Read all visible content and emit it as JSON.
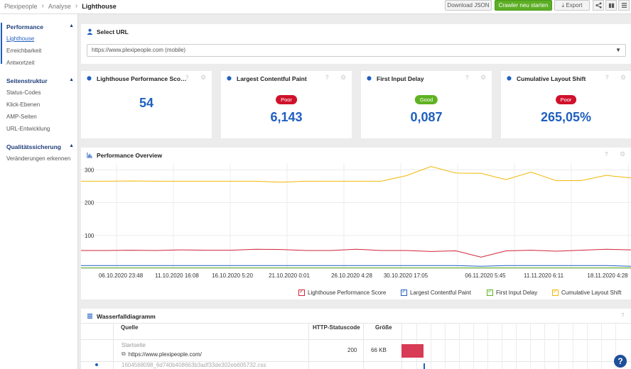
{
  "breadcrumb": {
    "items": [
      "Plexipeople",
      "Analyse"
    ],
    "current": "Lighthouse"
  },
  "toolbar": {
    "download_json": "Download JSON",
    "crawler_restart": "Crawler neu starten",
    "export": "Export"
  },
  "sidebar": {
    "sections": [
      {
        "title": "Performance",
        "items": [
          "Lighthouse",
          "Erreichbarkeit",
          "Antwortzeit"
        ]
      },
      {
        "title": "Seitenstruktur",
        "items": [
          "Status-Codes",
          "Klick-Ebenen",
          "AMP-Seiten",
          "URL-Entwicklung"
        ]
      },
      {
        "title": "Qualitätssicherung",
        "items": [
          "Veränderungen erkennen"
        ]
      }
    ]
  },
  "select_url": {
    "title": "Select URL",
    "value": "https://www.plexipeople.com (mobile)"
  },
  "metrics": [
    {
      "title": "Lighthouse Performance Sco…",
      "value": "54",
      "badge": ""
    },
    {
      "title": "Largest Contentful Paint",
      "value": "6,143",
      "badge": "Poor"
    },
    {
      "title": "First Input Delay",
      "value": "0,087",
      "badge": "Good"
    },
    {
      "title": "Cumulative Layout Shift",
      "value": "265,05%",
      "badge": "Poor"
    }
  ],
  "colors": {
    "poor": "#d0112b",
    "good": "#5fb221",
    "accent": "#1f5fbf"
  },
  "overview": {
    "title": "Performance Overview"
  },
  "chart_data": {
    "type": "line",
    "title": "Performance Overview",
    "x": [
      "06.10.2020 23:48",
      "11.10.2020 16:08",
      "16.10.2020 5:20",
      "21.10.2020 0:01",
      "26.10.2020 4:28",
      "30.10.2020 17:05",
      "06.11.2020 5:45",
      "11.11.2020 6:11",
      "18.11.2020 4:28"
    ],
    "yticks": [
      100,
      200,
      300
    ],
    "ylim": [
      0,
      320
    ],
    "grid": true,
    "series": [
      {
        "name": "Lighthouse Performance Score",
        "color": "#d0243a",
        "values": [
          54,
          54,
          55,
          54,
          56,
          55,
          55,
          58,
          57,
          54,
          54,
          58,
          54,
          54,
          51,
          53,
          34,
          53,
          55,
          52,
          55,
          58,
          56
        ]
      },
      {
        "name": "Largest Contentful Paint",
        "color": "#1f5fbf",
        "values": [
          8,
          8,
          8,
          8,
          8,
          8,
          8,
          8,
          8,
          8,
          8,
          8,
          8,
          8,
          8,
          8,
          6,
          8,
          8,
          8,
          8,
          8,
          6
        ]
      },
      {
        "name": "First Input Delay",
        "color": "#5fb221",
        "values": [
          1,
          1,
          1,
          1,
          1,
          1,
          1,
          1,
          1,
          1,
          1,
          1,
          1,
          1,
          1,
          1,
          1,
          1,
          1,
          1,
          1,
          1,
          1
        ]
      },
      {
        "name": "Cumulative Layout Shift",
        "color": "#f2b705",
        "values": [
          265,
          265,
          266,
          265,
          265,
          265,
          265,
          265,
          262,
          265,
          265,
          265,
          265,
          282,
          310,
          290,
          289,
          270,
          293,
          267,
          267,
          283,
          275
        ]
      }
    ]
  },
  "waterfall": {
    "title": "Wasserfalldiagramm",
    "columns": [
      "Quelle",
      "HTTP-Statuscode",
      "Größe"
    ],
    "rows": [
      {
        "label": "Startseite",
        "url": "https://www.plexipeople.com/",
        "status": "200",
        "size": "66 KB"
      },
      {
        "label": "1604568098_6d740b408663b3adf33de302eb605732.css",
        "url": "",
        "status": "",
        "size": ""
      }
    ]
  }
}
